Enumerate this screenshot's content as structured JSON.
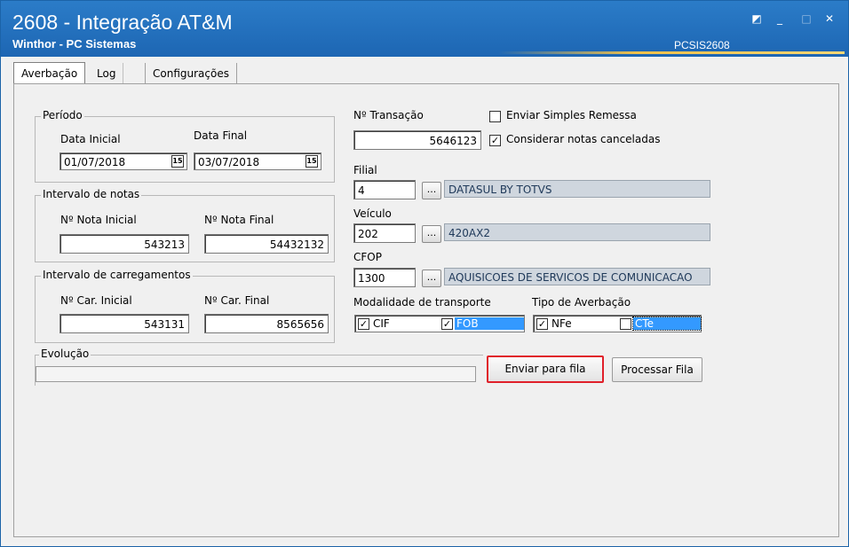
{
  "window": {
    "title": "2608 - Integração AT&M",
    "subtitle": "Winthor - PC Sistemas",
    "program_code": "PCSIS2608",
    "controls": {
      "restore": "◩",
      "minimize": "_",
      "maximize": "□",
      "close": "✕"
    }
  },
  "tabs": [
    {
      "label": "Averbação",
      "active": true
    },
    {
      "label": "Log",
      "active": false
    },
    {
      "label": "Configurações",
      "active": false
    }
  ],
  "periodo": {
    "title": "Período",
    "data_inicial_label": "Data Inicial",
    "data_inicial": "01/07/2018",
    "data_final_label": "Data Final",
    "data_final": "03/07/2018",
    "calendar_glyph": "15"
  },
  "notas": {
    "title": "Intervalo de notas",
    "inicial_label": "Nº Nota Inicial",
    "inicial": "543213",
    "final_label": "Nº Nota Final",
    "final": "54432132"
  },
  "carregamentos": {
    "title": "Intervalo de carregamentos",
    "inicial_label": "Nº Car. Inicial",
    "inicial": "543131",
    "final_label": "Nº Car. Final",
    "final": "8565656"
  },
  "transacao": {
    "label": "Nº Transação",
    "value": "5646123"
  },
  "options": {
    "enviar_simples_remessa": {
      "label": "Enviar Simples Remessa",
      "checked": false
    },
    "considerar_canceladas": {
      "label": "Considerar notas canceladas",
      "checked": true
    }
  },
  "filial": {
    "label": "Filial",
    "code": "4",
    "desc": "DATASUL BY TOTVS"
  },
  "veiculo": {
    "label": "Veículo",
    "code": "202",
    "desc": "420AX2"
  },
  "cfop": {
    "label": "CFOP",
    "code": "1300",
    "desc": "AQUISICOES DE SERVICOS DE COMUNICACAO"
  },
  "lookup_button": "...",
  "modalidade": {
    "label": "Modalidade de transporte",
    "cif": {
      "label": "CIF",
      "checked": true
    },
    "fob": {
      "label": "FOB",
      "checked": true
    }
  },
  "tipo_averbacao": {
    "label": "Tipo de Averbação",
    "nfe": {
      "label": "NFe",
      "checked": true
    },
    "cte": {
      "label": "CTe",
      "checked": false
    }
  },
  "check_glyph": "✓",
  "evolucao": {
    "title": "Evolução",
    "progress": 0
  },
  "buttons": {
    "enviar_fila": "Enviar para fila",
    "processar_fila": "Processar Fila"
  },
  "colors": {
    "titlebar": "#1d66b3",
    "highlight": "#3399ff",
    "focus_border": "#e0202a"
  }
}
